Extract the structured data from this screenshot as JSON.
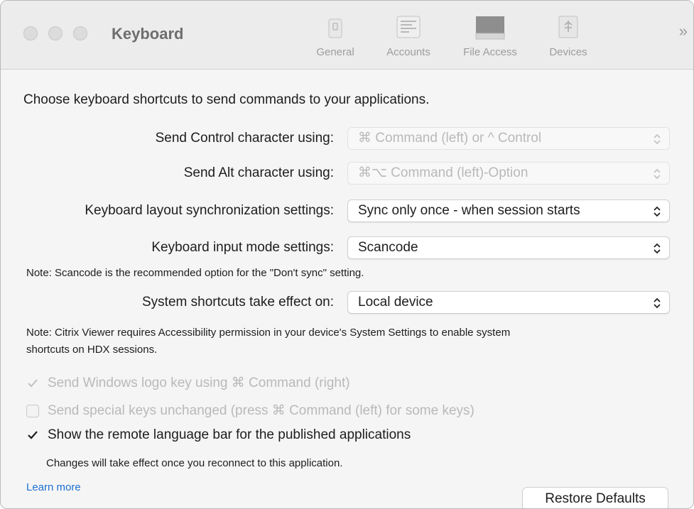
{
  "window": {
    "title": "Keyboard",
    "overflow_glyph": "»"
  },
  "toolbar": {
    "items": [
      {
        "label": "General",
        "icon": "general-icon"
      },
      {
        "label": "Accounts",
        "icon": "accounts-icon"
      },
      {
        "label": "File Access",
        "icon": "file-access-icon"
      },
      {
        "label": "Devices",
        "icon": "devices-icon"
      }
    ]
  },
  "intro": "Choose keyboard shortcuts to send commands to your applications.",
  "settings": {
    "control_char": {
      "label": "Send Control character using:",
      "value": "⌘ Command (left) or ^ Control",
      "enabled": false
    },
    "alt_char": {
      "label": "Send Alt character using:",
      "value": "⌘⌥ Command (left)-Option",
      "enabled": false
    },
    "layout_sync": {
      "label": "Keyboard layout synchronization settings:",
      "value": "Sync only once - when session starts",
      "enabled": true
    },
    "input_mode": {
      "label": "Keyboard input mode settings:",
      "value": "Scancode",
      "enabled": true
    },
    "input_mode_note": "Note: Scancode is the recommended option for the \"Don't sync\" setting.",
    "system_shortcuts": {
      "label": "System shortcuts take effect on:",
      "value": "Local device",
      "enabled": true
    },
    "system_shortcuts_note_line1": "Note: Citrix Viewer requires Accessibility permission in your device's System Settings to enable system",
    "system_shortcuts_note_line2": "shortcuts on HDX sessions."
  },
  "checkboxes": [
    {
      "label": "Send Windows logo key using ⌘ Command (right)",
      "checked": true,
      "enabled": false
    },
    {
      "label": "Send special keys unchanged (press ⌘ Command (left) for some keys)",
      "checked": false,
      "enabled": false
    },
    {
      "label": "Show the remote language bar for the published applications",
      "checked": true,
      "enabled": true
    }
  ],
  "reconnect_note": "Changes will take effect once you reconnect to this application.",
  "learn_more": "Learn more",
  "restore_button": "Restore Defaults",
  "colors": {
    "link": "#1f6fd1",
    "disabled_text": "#b9b9b9",
    "window_bg": "#f5f5f5"
  }
}
